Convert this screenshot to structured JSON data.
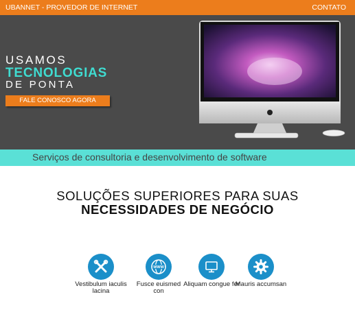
{
  "topbar": {
    "brand": "UBANNET - PROVEDOR DE INTERNET",
    "contact": "CONTATO"
  },
  "hero": {
    "line1": "USAMOS",
    "line2": "TECNOLOGIAS",
    "line3": "DE PONTA",
    "cta": "FALE CONOSCO AGORA"
  },
  "band": {
    "text": "Serviços de consultoria e desenvolvimento de software"
  },
  "section": {
    "title_line1": "SOLUÇÕES SUPERIORES PARA SUAS",
    "title_line2": "NECESSIDADES DE NEGÓCIO"
  },
  "features": [
    {
      "icon": "tools-icon",
      "label": "Vestibulum iaculis lacina"
    },
    {
      "icon": "globe-www-icon",
      "label": "Fusce euismed con"
    },
    {
      "icon": "monitor-icon",
      "label": "Aliquam congue fer"
    },
    {
      "icon": "gear-icon",
      "label": "Mauris accumsan"
    }
  ],
  "colors": {
    "accent": "#ec7d1c",
    "teal": "#5ae0d6",
    "dark": "#4a4a4a",
    "icon_blue": "#1b8fc9"
  }
}
